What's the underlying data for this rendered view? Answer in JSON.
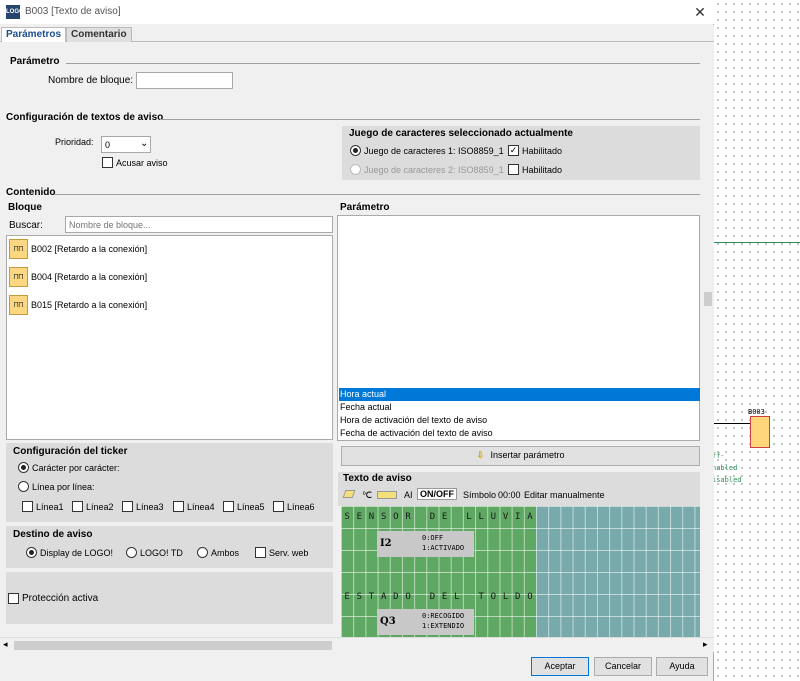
{
  "window": {
    "title": "B003 [Texto de aviso]",
    "icon_text": "LOGO",
    "close": "✕"
  },
  "tabs": [
    {
      "label": "Parámetros"
    },
    {
      "label": "Comentario"
    }
  ],
  "parametro": {
    "title": "Parámetro",
    "nombre_label": "Nombre de bloque:",
    "nombre_value": ""
  },
  "config": {
    "title": "Configuración de textos de aviso",
    "prioridad_label": "Prioridad:",
    "prioridad_value": "0",
    "acusar_label": "Acusar aviso",
    "charset": {
      "title": "Juego de caracteres seleccionado actualmente",
      "set1_label": "Juego de caracteres 1: ISO8859_1",
      "set2_label": "Juego de caracteres 2: ISO8859_1",
      "habilitado1": "Habilitado",
      "habilitado2": "Habilitado"
    }
  },
  "contenido": {
    "title": "Contenido",
    "bloque_title": "Bloque",
    "buscar_label": "Buscar:",
    "buscar_placeholder": "Nombre de bloque...",
    "blocks": [
      {
        "label": "B002 [Retardo a la conexión]"
      },
      {
        "label": "B004 [Retardo a la conexión]"
      },
      {
        "label": "B015 [Retardo a la conexión]"
      }
    ],
    "param_title": "Parámetro",
    "param_items": [
      "Hora actual",
      "Fecha actual",
      "Hora de activación del texto de aviso",
      "Fecha de activación del texto de aviso"
    ],
    "insertar_label": "Insertar parámetro"
  },
  "ticker": {
    "title": "Configuración del ticker",
    "caracter": "Carácter por carácter:",
    "linea": "Línea por línea:",
    "lineas": [
      "Línea1",
      "Línea2",
      "Línea3",
      "Línea4",
      "Línea5",
      "Línea6"
    ]
  },
  "destino": {
    "title": "Destino de aviso",
    "options": [
      "Display de LOGO!",
      "LOGO! TD",
      "Ambos"
    ],
    "serv_web": "Serv. web"
  },
  "proteccion": "Protección activa",
  "texto": {
    "title": "Texto de aviso",
    "toolbar": {
      "celsius": "℃",
      "ai": "AI",
      "onoff": "ON/OFF",
      "simbolo": "Símbolo",
      "time": "00:00",
      "editar": "Editar manualmente"
    },
    "line1": "SENSOR DE LLUVIA",
    "line3": "ESTADO DEL TOLDO",
    "param1": {
      "name": "I2",
      "s0": "0:OFF",
      "s1": "1:ACTIVADO"
    },
    "param2": {
      "name": "Q3",
      "s0": "0:RECOGIDO",
      "s1": "1:EXTENDIO"
    }
  },
  "buttons": {
    "aceptar": "Aceptar",
    "cancelar": "Cancelar",
    "ayuda": "Ayuda"
  },
  "canvas": {
    "block_label": "B003",
    "t1": "ff-",
    "t2": "nabled",
    "t3": "isabled"
  }
}
